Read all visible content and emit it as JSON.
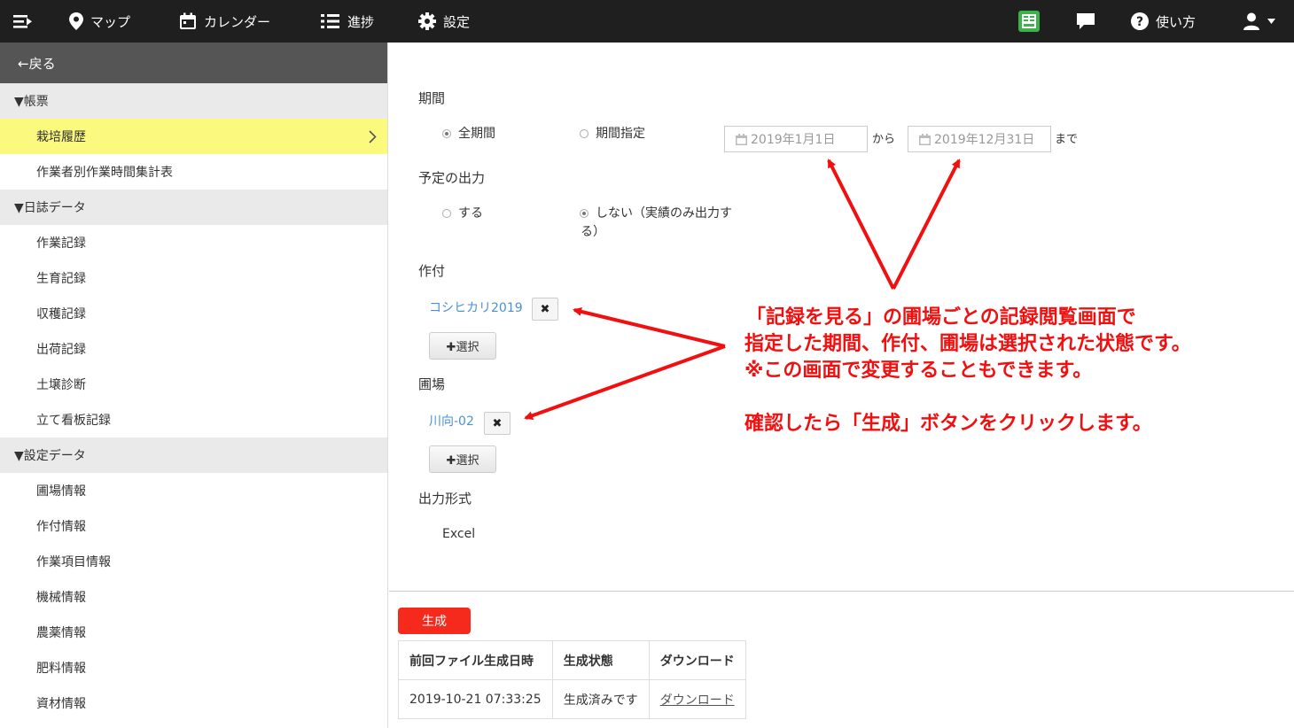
{
  "nav": {
    "map": "マップ",
    "calendar": "カレンダー",
    "progress": "進捗",
    "settings": "設定",
    "help": "使い方"
  },
  "sidebar": {
    "back": "←戻る",
    "sections": [
      {
        "title": "▼帳票",
        "items": [
          "栽培履歴",
          "作業者別作業時間集計表"
        ]
      },
      {
        "title": "▼日誌データ",
        "items": [
          "作業記録",
          "生育記録",
          "収穫記録",
          "出荷記録",
          "土壌診断",
          "立て看板記録"
        ]
      },
      {
        "title": "▼設定データ",
        "items": [
          "圃場情報",
          "作付情報",
          "作業項目情報",
          "機械情報",
          "農薬情報",
          "肥料情報",
          "資材情報"
        ]
      }
    ],
    "active_item": "栽培履歴"
  },
  "form": {
    "period": {
      "label": "期間",
      "option_all": "全期間",
      "option_range": "期間指定",
      "from": "2019年1月1日",
      "from_suffix": "から",
      "to": "2019年12月31日",
      "to_suffix": "まで",
      "selected": "全期間"
    },
    "planned": {
      "label": "予定の出力",
      "option_yes": "する",
      "option_no_line1": "しない（実績のみ出力す",
      "option_no_line2": "る）",
      "selected": "しない"
    },
    "crop": {
      "label": "作付",
      "selected_tag": "コシヒカリ2019",
      "remove_icon": "✖",
      "select_button": "✚選択"
    },
    "field": {
      "label": "圃場",
      "selected_tag": "川向-02",
      "remove_icon": "✖",
      "select_button": "✚選択"
    },
    "format": {
      "label": "出力形式",
      "value": "Excel"
    }
  },
  "generate_button": "生成",
  "results": {
    "headers": [
      "前回ファイル生成日時",
      "生成状態",
      "ダウンロード"
    ],
    "row": [
      "2019-10-21 07:33:25",
      "生成済みです",
      "ダウンロード"
    ]
  },
  "annotation": {
    "line1": "「記録を見る」の圃場ごとの記録閲覧画面で",
    "line2": "指定した期間、作付、圃場は選択された状態です。",
    "line3": "※この画面で変更することもできます。",
    "line4": "確認したら「生成」ボタンをクリックします。",
    "color": "#f20f0f"
  },
  "colors": {
    "topbar": "#1f1f1f",
    "active_item": "#fbf97e",
    "generate": "#f6291d",
    "book_icon": "#3cb24a",
    "link": "#4a90d9"
  }
}
